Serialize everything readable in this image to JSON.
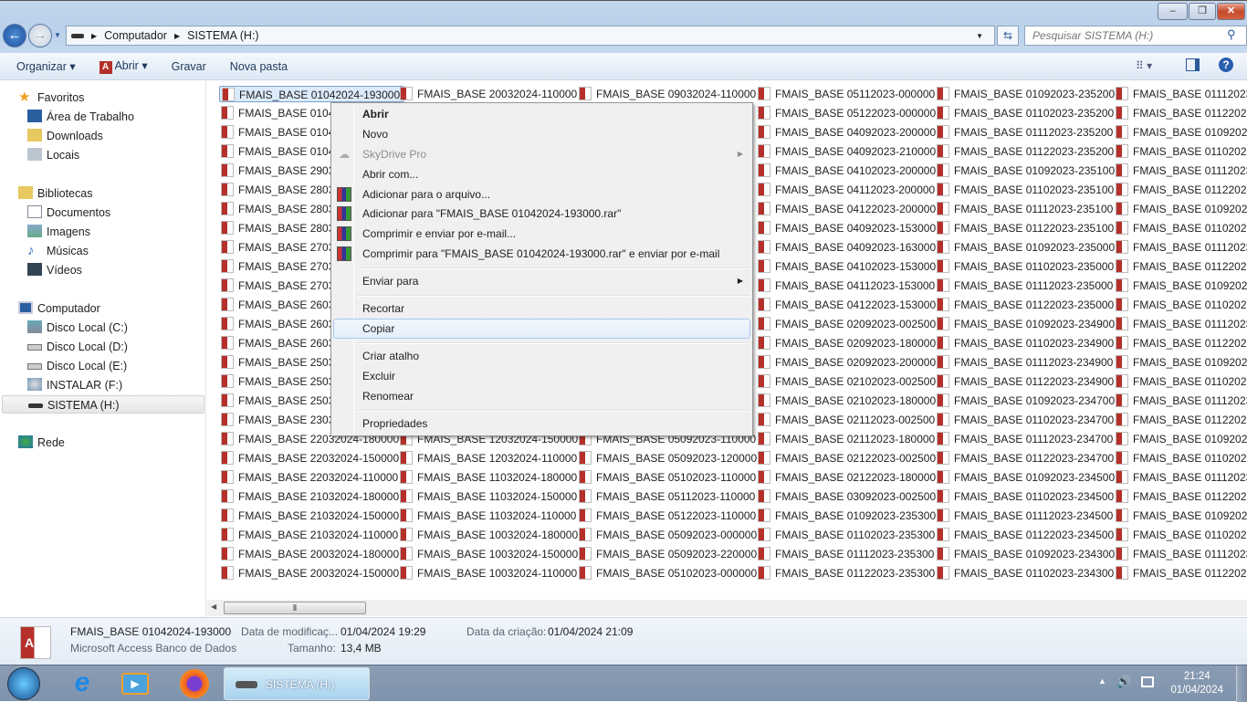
{
  "window": {
    "minimize": "–",
    "restore": "❐",
    "close": "✕"
  },
  "nav": {
    "back_icon": "back-arrow-icon",
    "forward_icon": "forward-arrow-icon"
  },
  "address": {
    "crumbs": [
      "Computador",
      "SISTEMA (H:)"
    ]
  },
  "search": {
    "placeholder": "Pesquisar SISTEMA (H:)"
  },
  "toolbar": {
    "organize": "Organizar",
    "open": "Abrir",
    "burn": "Gravar",
    "new_folder": "Nova pasta"
  },
  "sidebar": {
    "favorites": "Favoritos",
    "fav_items": [
      "Área de Trabalho",
      "Downloads",
      "Locais"
    ],
    "libraries": "Bibliotecas",
    "lib_items": [
      "Documentos",
      "Imagens",
      "Músicas",
      "Vídeos"
    ],
    "computer": "Computador",
    "comp_items": [
      "Disco Local (C:)",
      "Disco Local (D:)",
      "Disco Local (E:)",
      "INSTALAR (F:)",
      "SISTEMA (H:)"
    ],
    "network": "Rede"
  },
  "files": {
    "columns": [
      [
        "FMAIS_BASE 01042024-193000",
        "FMAIS_BASE 01042",
        "FMAIS_BASE 01042",
        "FMAIS_BASE 01042",
        "FMAIS_BASE 29032",
        "FMAIS_BASE 28032",
        "FMAIS_BASE 28032",
        "FMAIS_BASE 28032",
        "FMAIS_BASE 27032",
        "FMAIS_BASE 27032",
        "FMAIS_BASE 27032",
        "FMAIS_BASE 26032",
        "FMAIS_BASE 26032",
        "FMAIS_BASE 26032",
        "FMAIS_BASE 25032",
        "FMAIS_BASE 25032",
        "FMAIS_BASE 25032",
        "FMAIS_BASE 23032",
        "FMAIS_BASE 22032024-180000",
        "FMAIS_BASE 22032024-150000",
        "FMAIS_BASE 22032024-110000",
        "FMAIS_BASE 21032024-180000",
        "FMAIS_BASE 21032024-150000",
        "FMAIS_BASE 21032024-110000",
        "FMAIS_BASE 20032024-180000",
        "FMAIS_BASE 20032024-150000"
      ],
      [
        "FMAIS_BASE 20032024-110000",
        "",
        "",
        "",
        "",
        "",
        "",
        "",
        "",
        "",
        "",
        "",
        "",
        "",
        "",
        "",
        "",
        "",
        "FMAIS_BASE 12032024-150000",
        "FMAIS_BASE 12032024-110000",
        "FMAIS_BASE 11032024-180000",
        "FMAIS_BASE 11032024-150000",
        "FMAIS_BASE 11032024-110000",
        "FMAIS_BASE 10032024-180000",
        "FMAIS_BASE 10032024-150000",
        "FMAIS_BASE 10032024-110000"
      ],
      [
        "FMAIS_BASE 09032024-110000",
        "",
        "",
        "",
        "",
        "",
        "",
        "",
        "",
        "",
        "",
        "",
        "",
        "",
        "",
        "",
        "",
        "",
        "FMAIS_BASE 05092023-110000",
        "FMAIS_BASE 05092023-120000",
        "FMAIS_BASE 05102023-110000",
        "FMAIS_BASE 05112023-110000",
        "FMAIS_BASE 05122023-110000",
        "FMAIS_BASE 05092023-000000",
        "FMAIS_BASE 05092023-220000",
        "FMAIS_BASE 05102023-000000"
      ],
      [
        "FMAIS_BASE 05112023-000000",
        "FMAIS_BASE 05122023-000000",
        "FMAIS_BASE 04092023-200000",
        "FMAIS_BASE 04092023-210000",
        "FMAIS_BASE 04102023-200000",
        "FMAIS_BASE 04112023-200000",
        "FMAIS_BASE 04122023-200000",
        "FMAIS_BASE 04092023-153000",
        "FMAIS_BASE 04092023-163000",
        "FMAIS_BASE 04102023-153000",
        "FMAIS_BASE 04112023-153000",
        "FMAIS_BASE 04122023-153000",
        "FMAIS_BASE 02092023-002500",
        "FMAIS_BASE 02092023-180000",
        "FMAIS_BASE 02092023-200000",
        "FMAIS_BASE 02102023-002500",
        "FMAIS_BASE 02102023-180000",
        "FMAIS_BASE 02112023-002500",
        "FMAIS_BASE 02112023-180000",
        "FMAIS_BASE 02122023-002500",
        "FMAIS_BASE 02122023-180000",
        "FMAIS_BASE 03092023-002500",
        "FMAIS_BASE 01092023-235300",
        "FMAIS_BASE 01102023-235300",
        "FMAIS_BASE 01112023-235300",
        "FMAIS_BASE 01122023-235300"
      ],
      [
        "FMAIS_BASE 01092023-235200",
        "FMAIS_BASE 01102023-235200",
        "FMAIS_BASE 01112023-235200",
        "FMAIS_BASE 01122023-235200",
        "FMAIS_BASE 01092023-235100",
        "FMAIS_BASE 01102023-235100",
        "FMAIS_BASE 01112023-235100",
        "FMAIS_BASE 01122023-235100",
        "FMAIS_BASE 01092023-235000",
        "FMAIS_BASE 01102023-235000",
        "FMAIS_BASE 01112023-235000",
        "FMAIS_BASE 01122023-235000",
        "FMAIS_BASE 01092023-234900",
        "FMAIS_BASE 01102023-234900",
        "FMAIS_BASE 01112023-234900",
        "FMAIS_BASE 01122023-234900",
        "FMAIS_BASE 01092023-234700",
        "FMAIS_BASE 01102023-234700",
        "FMAIS_BASE 01112023-234700",
        "FMAIS_BASE 01122023-234700",
        "FMAIS_BASE 01092023-234500",
        "FMAIS_BASE 01102023-234500",
        "FMAIS_BASE 01112023-234500",
        "FMAIS_BASE 01122023-234500",
        "FMAIS_BASE 01092023-234300",
        "FMAIS_BASE 01102023-234300"
      ],
      [
        "FMAIS_BASE 01112023-",
        "FMAIS_BASE 01122023-",
        "FMAIS_BASE 01092023-",
        "FMAIS_BASE 01102023-",
        "FMAIS_BASE 01112023-",
        "FMAIS_BASE 01122023-",
        "FMAIS_BASE 01092023-",
        "FMAIS_BASE 01102023-",
        "FMAIS_BASE 01112023-",
        "FMAIS_BASE 01122023-",
        "FMAIS_BASE 01092023-",
        "FMAIS_BASE 01102023-",
        "FMAIS_BASE 01112023-",
        "FMAIS_BASE 01122023-",
        "FMAIS_BASE 01092023-",
        "FMAIS_BASE 01102023-",
        "FMAIS_BASE 01112023-",
        "FMAIS_BASE 01122023-",
        "FMAIS_BASE 01092023-",
        "FMAIS_BASE 01102023-",
        "FMAIS_BASE 01112023-",
        "FMAIS_BASE 01122023-",
        "FMAIS_BASE 01092023-",
        "FMAIS_BASE 01102023-",
        "FMAIS_BASE 01112023-",
        "FMAIS_BASE 01122023-"
      ]
    ],
    "selected": "FMAIS_BASE 01042024-193000"
  },
  "context_menu": {
    "open": "Abrir",
    "new": "Novo",
    "skydrive": "SkyDrive Pro",
    "open_with": "Abrir com...",
    "add_archive": "Adicionar para o arquivo...",
    "add_rar": "Adicionar para \"FMAIS_BASE 01042024-193000.rar\"",
    "compress_email": "Comprimir e enviar por e-mail...",
    "compress_rar_email": "Comprimir para \"FMAIS_BASE 01042024-193000.rar\" e enviar por e-mail",
    "send_to": "Enviar para",
    "cut": "Recortar",
    "copy": "Copiar",
    "shortcut": "Criar atalho",
    "delete": "Excluir",
    "rename": "Renomear",
    "properties": "Propriedades"
  },
  "details": {
    "name": "FMAIS_BASE 01042024-193000",
    "type": "Microsoft Access Banco de Dados",
    "modified_label": "Data de modificaç...",
    "modified": "01/04/2024 19:29",
    "size_label": "Tamanho:",
    "size": "13,4 MB",
    "created_label": "Data da criação:",
    "created": "01/04/2024 21:09"
  },
  "taskbar": {
    "active_window": "SISTEMA (H:)",
    "time": "21:24",
    "date": "01/04/2024"
  },
  "colors": {
    "selection": "#dcebfc",
    "access_red": "#b5302a",
    "taskbar": "#8498b1"
  }
}
